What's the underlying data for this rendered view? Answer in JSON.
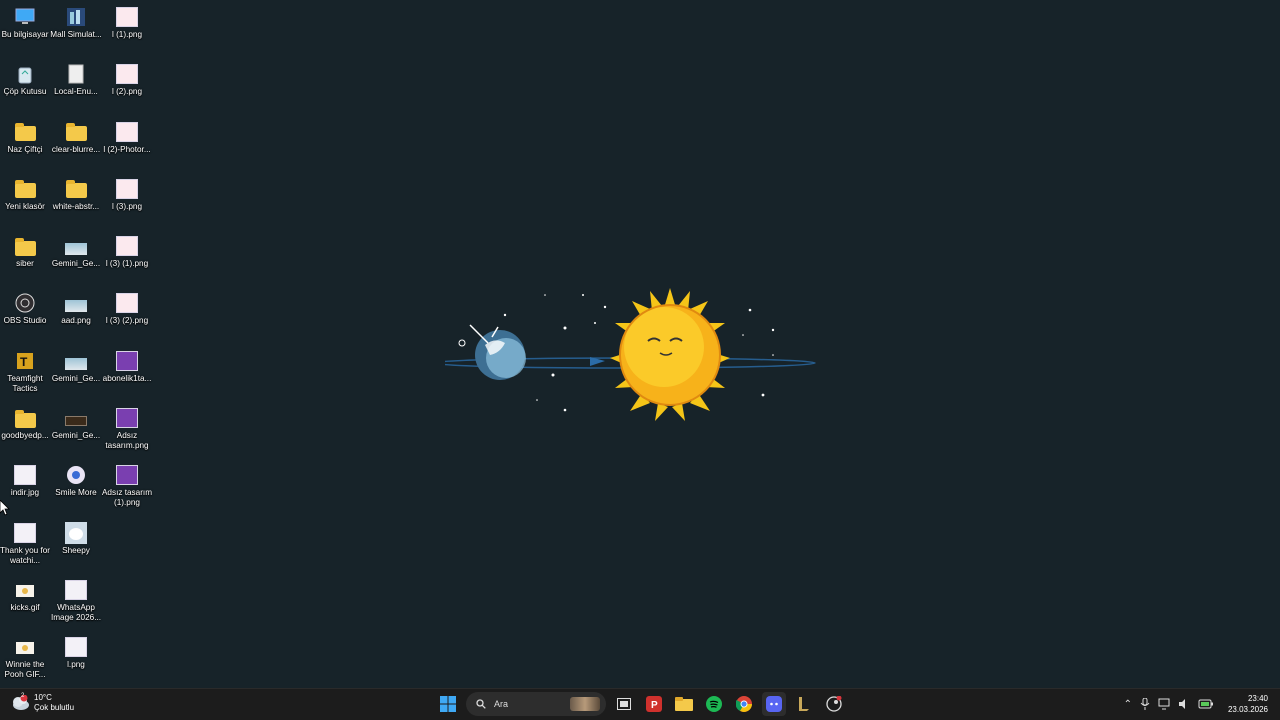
{
  "desktop": {
    "icons": [
      {
        "label": "Bu bilgisayar",
        "icon": "computer-icon"
      },
      {
        "label": "Çöp Kutusu",
        "icon": "recycle-bin-icon"
      },
      {
        "label": "Naz Çiftçi",
        "icon": "folder-icon"
      },
      {
        "label": "Yeni klasör",
        "icon": "folder-icon"
      },
      {
        "label": "siber",
        "icon": "folder-icon"
      },
      {
        "label": "OBS Studio",
        "icon": "obs-icon"
      },
      {
        "label": "Teamfight Tactics",
        "icon": "tft-icon"
      },
      {
        "label": "goodbyedp...",
        "icon": "folder-icon"
      },
      {
        "label": "indir.jpg",
        "icon": "image-icon"
      },
      {
        "label": "Thank you for watchi...",
        "icon": "image-icon"
      },
      {
        "label": "kicks.gif",
        "icon": "gif-icon"
      },
      {
        "label": "Winnie the Pooh GIF...",
        "icon": "gif-icon"
      },
      {
        "label": "Mall Simulat...",
        "icon": "game-icon"
      },
      {
        "label": "Local-Enu...",
        "icon": "file-icon"
      },
      {
        "label": "clear-blurre...",
        "icon": "folder-icon"
      },
      {
        "label": "white-abstr...",
        "icon": "folder-icon"
      },
      {
        "label": "Gemini_Ge...",
        "icon": "image-icon"
      },
      {
        "label": "aad.png",
        "icon": "image-icon"
      },
      {
        "label": "Gemini_Ge...",
        "icon": "image-icon"
      },
      {
        "label": "Gemini_Ge...",
        "icon": "image-icon"
      },
      {
        "label": "Smile More",
        "icon": "app-icon"
      },
      {
        "label": "Sheepy",
        "icon": "sheep-icon"
      },
      {
        "label": "WhatsApp Image 2026...",
        "icon": "image-icon"
      },
      {
        "label": "l.png",
        "icon": "image-icon"
      },
      {
        "label": "l (1).png",
        "icon": "image-icon"
      },
      {
        "label": "l (2).png",
        "icon": "image-icon"
      },
      {
        "label": "l (2)-Photor...",
        "icon": "image-icon"
      },
      {
        "label": "l (3).png",
        "icon": "image-icon"
      },
      {
        "label": "l (3) (1).png",
        "icon": "image-icon"
      },
      {
        "label": "l (3) (2).png",
        "icon": "image-icon"
      },
      {
        "label": "abonelik1ta...",
        "icon": "image-icon"
      },
      {
        "label": "Adsız tasarım.png",
        "icon": "image-icon"
      },
      {
        "label": "Adsız tasarım (1).png",
        "icon": "image-icon"
      }
    ]
  },
  "taskbar": {
    "weather": {
      "temp": "10°C",
      "desc": "Çok bulutlu",
      "badge": "2"
    },
    "search_placeholder": "Ara",
    "apps": [
      "windows-start-icon",
      "task-view-icon",
      "pocket-icon",
      "file-explorer-icon",
      "spotify-icon",
      "chrome-icon",
      "discord-icon",
      "league-icon",
      "steam-icon"
    ],
    "clock": {
      "time": "23:40",
      "date": "23.03.2026"
    },
    "colors": {
      "background": "#1c1c1c",
      "spotify": "#1db954",
      "discord": "#5865f2"
    }
  }
}
